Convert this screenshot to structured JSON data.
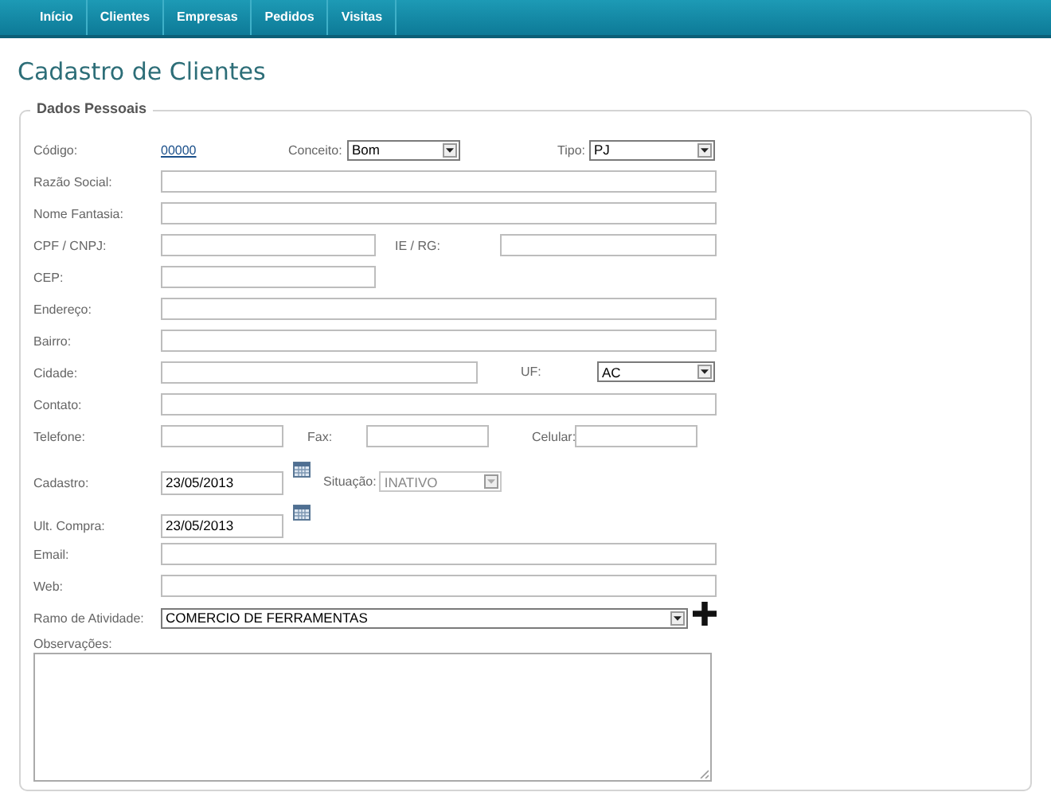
{
  "nav": [
    "Início",
    "Clientes",
    "Empresas",
    "Pedidos",
    "Visitas"
  ],
  "page_title": "Cadastro de Clientes",
  "section_title": "Dados Pessoais",
  "rows": [
    {
      "kind": "mixed",
      "label": "Código:",
      "segments": [
        {
          "kind": "link",
          "value": "00000"
        },
        {
          "kind": "select",
          "label": "Conceito:",
          "value": "Bom",
          "disabled": false
        },
        {
          "kind": "select",
          "label": "Tipo:",
          "value": "PJ",
          "disabled": false
        }
      ]
    },
    {
      "kind": "mixed",
      "label": "Razão Social:",
      "segments": [
        {
          "kind": "text"
        }
      ]
    },
    {
      "kind": "mixed",
      "label": "Nome Fantasia:",
      "segments": [
        {
          "kind": "text"
        }
      ]
    },
    {
      "kind": "mixed",
      "label": "CPF / CNPJ:",
      "segments": [
        {
          "kind": "text"
        },
        {
          "kind": "text",
          "label": "IE / RG:"
        }
      ]
    },
    {
      "kind": "mixed",
      "label": "CEP:",
      "segments": [
        {
          "kind": "short"
        }
      ]
    },
    {
      "kind": "mixed",
      "label": "Endereço:",
      "segments": [
        {
          "kind": "text"
        }
      ]
    },
    {
      "kind": "mixed",
      "label": "Bairro:",
      "segments": [
        {
          "kind": "text"
        }
      ]
    },
    {
      "kind": "mixed",
      "label": "Cidade:",
      "segments": [
        {
          "kind": "text"
        },
        {
          "kind": "select",
          "label": "UF:",
          "value": "AC",
          "disabled": false
        }
      ]
    },
    {
      "kind": "mixed",
      "label": "Contato:",
      "segments": [
        {
          "kind": "text"
        }
      ]
    },
    {
      "kind": "mixed",
      "label": "Telefone:",
      "segments": [
        {
          "kind": "text"
        },
        {
          "kind": "text",
          "label": "Fax:"
        },
        {
          "kind": "text",
          "label": "Celular:"
        }
      ]
    },
    {
      "kind": "tall",
      "label": "Cadastro:",
      "segments": [
        {
          "kind": "date",
          "value": "23/05/2013"
        },
        {
          "kind": "select",
          "label": "Situação:",
          "value": "INATIVO",
          "disabled": true
        }
      ]
    },
    {
      "kind": "tall",
      "label": "Ult. Compra:",
      "segments": [
        {
          "kind": "date",
          "value": "23/05/2013"
        }
      ]
    },
    {
      "kind": "mixed",
      "label": "Email:",
      "segments": [
        {
          "kind": "text"
        }
      ]
    },
    {
      "kind": "mixed",
      "label": "Web:",
      "segments": [
        {
          "kind": "text"
        }
      ]
    },
    {
      "kind": "mixed",
      "label": "Ramo de Atividade:",
      "segments": [
        {
          "kind": "wideselect",
          "value": "COMERCIO DE FERRAMENTAS",
          "disabled": false
        }
      ]
    },
    {
      "kind": "block",
      "label": "Observações:",
      "segments": [
        {
          "kind": "textarea"
        }
      ]
    }
  ]
}
